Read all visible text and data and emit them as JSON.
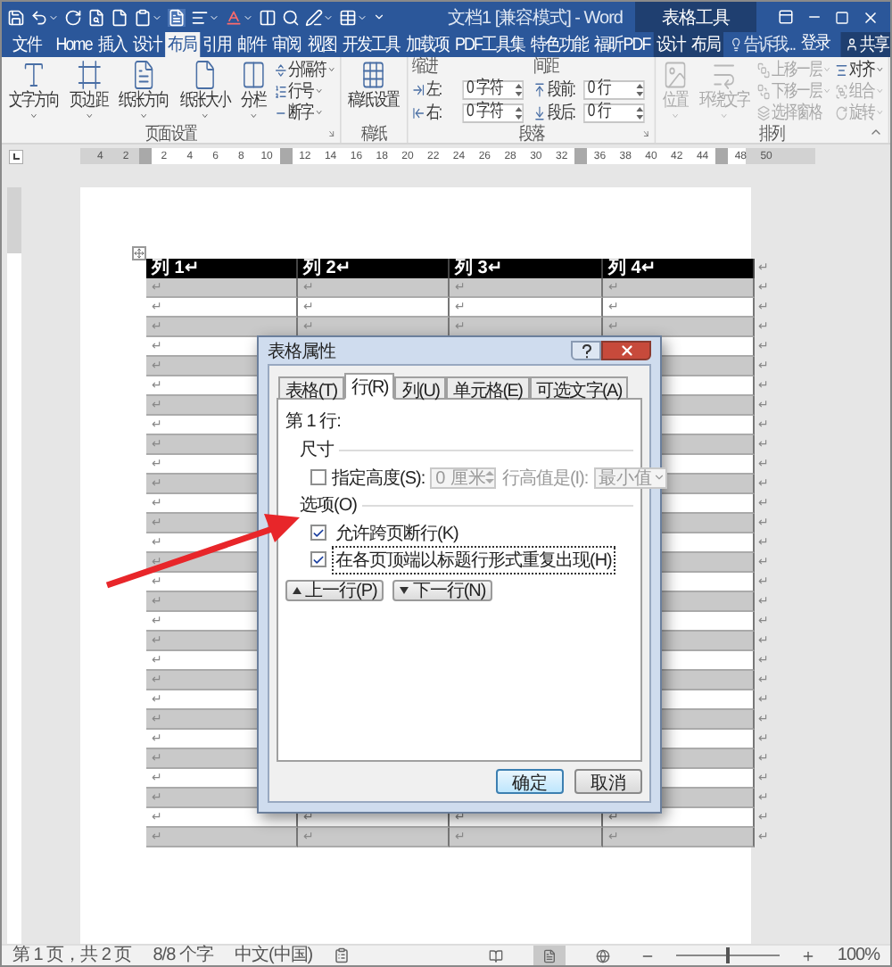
{
  "window": {
    "title": "文档1 [兼容模式] - Word",
    "context_title": "表格工具"
  },
  "tabs": [
    {
      "label": "文件",
      "kind": "file",
      "selected": false
    },
    {
      "label": "Home",
      "kind": "normal",
      "selected": false
    },
    {
      "label": "插入",
      "kind": "normal",
      "selected": false
    },
    {
      "label": "设计",
      "kind": "normal",
      "selected": false
    },
    {
      "label": "布局",
      "kind": "normal",
      "selected": true
    },
    {
      "label": "引用",
      "kind": "normal",
      "selected": false
    },
    {
      "label": "邮件",
      "kind": "normal",
      "selected": false
    },
    {
      "label": "审阅",
      "kind": "normal",
      "selected": false
    },
    {
      "label": "视图",
      "kind": "normal",
      "selected": false
    },
    {
      "label": "开发工具",
      "kind": "normal",
      "selected": false
    },
    {
      "label": "加载项",
      "kind": "normal",
      "selected": false
    },
    {
      "label": "PDF工具集",
      "kind": "normal",
      "selected": false
    },
    {
      "label": "特色功能",
      "kind": "normal",
      "selected": false
    },
    {
      "label": "福昕PDF",
      "kind": "normal",
      "selected": false
    },
    {
      "label": "设计",
      "kind": "context",
      "selected": false
    },
    {
      "label": "布局",
      "kind": "context",
      "selected": false
    }
  ],
  "tell_me": "告诉我...",
  "sign_in": "登录",
  "share": "共享",
  "ribbon": {
    "groups": [
      {
        "label": "页面设置",
        "launcher": true,
        "items": [
          {
            "kind": "large",
            "label": "文字方向",
            "dropdown": true,
            "disabled": false
          },
          {
            "kind": "large",
            "label": "页边距",
            "dropdown": true,
            "disabled": false
          },
          {
            "kind": "large",
            "label": "纸张方向",
            "dropdown": true,
            "disabled": false
          },
          {
            "kind": "large",
            "label": "纸张大小",
            "dropdown": true,
            "disabled": false
          },
          {
            "kind": "large",
            "label": "分栏",
            "dropdown": true,
            "disabled": false
          },
          {
            "kind": "stack",
            "items": [
              {
                "label": "分隔符",
                "dropdown": true,
                "disabled": false
              },
              {
                "label": "行号",
                "dropdown": true,
                "disabled": false
              },
              {
                "label": "断字",
                "dropdown": true,
                "disabled": false
              }
            ]
          }
        ]
      },
      {
        "label": "稿纸",
        "launcher": false,
        "items": [
          {
            "kind": "large",
            "label": "稿纸设置",
            "dropdown": false,
            "disabled": false
          }
        ]
      },
      {
        "label": "段落",
        "launcher": true,
        "items": [
          {
            "kind": "spins",
            "title": "缩进",
            "fields": [
              {
                "label": "左:",
                "value": "0 字符"
              },
              {
                "label": "右:",
                "value": "0 字符"
              }
            ]
          },
          {
            "kind": "spins",
            "title": "间距",
            "fields": [
              {
                "label": "段前:",
                "value": "0 行"
              },
              {
                "label": "段后:",
                "value": "0 行"
              }
            ]
          }
        ]
      },
      {
        "label": "排列",
        "launcher": false,
        "items": [
          {
            "kind": "large",
            "label": "位置",
            "dropdown": true,
            "disabled": true
          },
          {
            "kind": "large",
            "label": "环绕文字",
            "dropdown": true,
            "disabled": true
          },
          {
            "kind": "stack",
            "items": [
              {
                "label": "上移一层",
                "dropdown": true,
                "disabled": true
              },
              {
                "label": "下移一层",
                "dropdown": true,
                "disabled": true
              },
              {
                "label": "选择窗格",
                "dropdown": false,
                "disabled": true
              }
            ]
          },
          {
            "kind": "stack",
            "items": [
              {
                "label": "对齐",
                "dropdown": true,
                "disabled": false
              },
              {
                "label": "组合",
                "dropdown": true,
                "disabled": true
              },
              {
                "label": "旋转",
                "dropdown": true,
                "disabled": true
              }
            ]
          }
        ]
      }
    ]
  },
  "ruler": [
    {
      "kind": "num",
      "label": "4"
    },
    {
      "kind": "num",
      "label": "2"
    },
    {
      "kind": "marker"
    },
    {
      "kind": "num",
      "label": "2"
    },
    {
      "kind": "num",
      "label": "4"
    },
    {
      "kind": "num",
      "label": "6"
    },
    {
      "kind": "num",
      "label": "8"
    },
    {
      "kind": "num",
      "label": "10"
    },
    {
      "kind": "marker"
    },
    {
      "kind": "num",
      "label": "12"
    },
    {
      "kind": "num",
      "label": "14"
    },
    {
      "kind": "num",
      "label": "16"
    },
    {
      "kind": "num",
      "label": "18"
    },
    {
      "kind": "num",
      "label": "20"
    },
    {
      "kind": "num",
      "label": "22"
    },
    {
      "kind": "num",
      "label": "24"
    },
    {
      "kind": "num",
      "label": "26"
    },
    {
      "kind": "num",
      "label": "28"
    },
    {
      "kind": "num",
      "label": "30"
    },
    {
      "kind": "num",
      "label": "32"
    },
    {
      "kind": "marker"
    },
    {
      "kind": "num",
      "label": "36"
    },
    {
      "kind": "num",
      "label": "38"
    },
    {
      "kind": "num",
      "label": "40"
    },
    {
      "kind": "num",
      "label": "42"
    },
    {
      "kind": "num",
      "label": "44"
    },
    {
      "kind": "marker"
    },
    {
      "kind": "num",
      "label": "48"
    },
    {
      "kind": "num",
      "label": "50"
    }
  ],
  "table": {
    "columns": [
      "列 1↵",
      "列 2↵",
      "列 3↵",
      "列 4↵"
    ],
    "header_end": "↵",
    "rows": [
      {
        "shaded": true,
        "cells": [
          "↵",
          "↵",
          "↵",
          "↵"
        ],
        "end": "↵"
      },
      {
        "shaded": false,
        "cells": [
          "↵",
          "↵",
          "↵",
          "↵"
        ],
        "end": "↵"
      },
      {
        "shaded": true,
        "cells": [
          "↵",
          "↵",
          "↵",
          "↵"
        ],
        "end": "↵"
      },
      {
        "shaded": false,
        "cells": [
          "↵"
        ],
        "end": "↵"
      },
      {
        "shaded": true,
        "cells": [
          "↵"
        ],
        "end": "↵"
      },
      {
        "shaded": false,
        "cells": [
          "↵"
        ],
        "end": "↵"
      },
      {
        "shaded": true,
        "cells": [
          "↵"
        ],
        "end": "↵"
      },
      {
        "shaded": false,
        "cells": [
          "↵"
        ],
        "end": "↵"
      },
      {
        "shaded": true,
        "cells": [
          "↵"
        ],
        "end": "↵"
      },
      {
        "shaded": false,
        "cells": [
          "↵"
        ],
        "end": "↵"
      },
      {
        "shaded": true,
        "cells": [
          "↵"
        ],
        "end": "↵"
      },
      {
        "shaded": false,
        "cells": [
          "↵"
        ],
        "end": "↵"
      },
      {
        "shaded": true,
        "cells": [
          "↵"
        ],
        "end": "↵"
      },
      {
        "shaded": false,
        "cells": [
          "↵"
        ],
        "end": "↵"
      },
      {
        "shaded": true,
        "cells": [
          "↵"
        ],
        "end": "↵"
      },
      {
        "shaded": false,
        "cells": [
          "↵"
        ],
        "end": "↵"
      },
      {
        "shaded": true,
        "cells": [
          "↵"
        ],
        "end": "↵"
      },
      {
        "shaded": false,
        "cells": [
          "↵"
        ],
        "end": "↵"
      },
      {
        "shaded": true,
        "cells": [
          "↵"
        ],
        "end": "↵"
      },
      {
        "shaded": false,
        "cells": [
          "↵"
        ],
        "end": "↵"
      },
      {
        "shaded": true,
        "cells": [
          "↵"
        ],
        "end": "↵"
      },
      {
        "shaded": false,
        "cells": [
          "↵"
        ],
        "end": "↵"
      },
      {
        "shaded": true,
        "cells": [
          "↵"
        ],
        "end": "↵"
      },
      {
        "shaded": false,
        "cells": [
          "↵"
        ],
        "end": "↵"
      },
      {
        "shaded": true,
        "cells": [
          "↵"
        ],
        "end": "↵"
      },
      {
        "shaded": false,
        "cells": [
          "↵"
        ],
        "end": "↵"
      },
      {
        "shaded": true,
        "cells": [
          "↵"
        ],
        "end": "↵"
      },
      {
        "shaded": false,
        "cells": [
          "↵",
          "↵",
          "↵",
          "↵"
        ],
        "end": "↵"
      },
      {
        "shaded": true,
        "cells": [
          "↵",
          "↵",
          "↵",
          "↵"
        ],
        "end": "↵"
      }
    ]
  },
  "dialog": {
    "title": "表格属性",
    "tabs": [
      {
        "label": "表格(T)",
        "selected": false
      },
      {
        "label": "行(R)",
        "selected": true
      },
      {
        "label": "列(U)",
        "selected": false
      },
      {
        "label": "单元格(E)",
        "selected": false
      },
      {
        "label": "可选文字(A)",
        "selected": false
      }
    ],
    "row_heading": "第 1 行:",
    "size_label": "尺寸",
    "height_checkbox": {
      "label": "指定高度(S):",
      "checked": false
    },
    "height_field": {
      "value": "0 厘米",
      "disabled": true
    },
    "height_rule": {
      "label": "行高值是(I):",
      "value": "最小值",
      "disabled": true
    },
    "options_label": "选项(O)",
    "options": [
      {
        "label": "允许跨页断行(K)",
        "checked": true,
        "focused": false
      },
      {
        "label": "在各页顶端以标题行形式重复出现(H)",
        "checked": true,
        "focused": true
      }
    ],
    "nav_buttons": [
      {
        "label": "上一行(P)",
        "kind": "up"
      },
      {
        "label": "下一行(N)",
        "kind": "down"
      }
    ],
    "buttons": [
      {
        "label": "确定",
        "default": true
      },
      {
        "label": "取消",
        "default": false
      }
    ]
  },
  "status_bar": {
    "page": "第 1 页，共 2 页",
    "words": "8/8 个字",
    "language": "中文(中国)",
    "views": [
      {
        "selected": false
      },
      {
        "selected": true
      },
      {
        "selected": false
      }
    ],
    "zoom": {
      "level": 0.5,
      "label": "100%"
    }
  }
}
